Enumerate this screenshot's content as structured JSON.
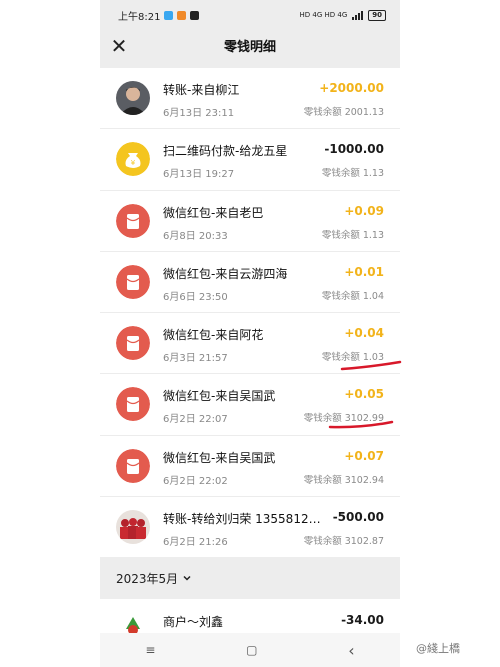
{
  "status": {
    "time": "上午8:21",
    "network": "HD 4G HD 4G",
    "battery": "90"
  },
  "header": {
    "title": "零钱明细",
    "close_icon": "close-icon"
  },
  "transactions": [
    {
      "title": "转账-来自柳江",
      "time": "6月13日 23:11",
      "amount": "+2000.00",
      "balance": "零钱余额 2001.13",
      "icon": "person-photo",
      "type": "pos"
    },
    {
      "title": "扫二维码付款-给龙五星",
      "time": "6月13日 19:27",
      "amount": "-1000.00",
      "balance": "零钱余额 1.13",
      "icon": "coin-bag-icon",
      "type": "neg"
    },
    {
      "title": "微信红包-来自老巴",
      "time": "6月8日 20:33",
      "amount": "+0.09",
      "balance": "零钱余额 1.13",
      "icon": "red-packet-icon",
      "type": "pos"
    },
    {
      "title": "微信红包-来自云游四海",
      "time": "6月6日 23:50",
      "amount": "+0.01",
      "balance": "零钱余额 1.04",
      "icon": "red-packet-icon",
      "type": "pos"
    },
    {
      "title": "微信红包-来自阿花",
      "time": "6月3日 21:57",
      "amount": "+0.04",
      "balance": "零钱余额 1.03",
      "icon": "red-packet-icon",
      "type": "pos"
    },
    {
      "title": "微信红包-来自吴国武",
      "time": "6月2日 22:07",
      "amount": "+0.05",
      "balance": "零钱余额 3102.99",
      "icon": "red-packet-icon",
      "type": "pos"
    },
    {
      "title": "微信红包-来自吴国武",
      "time": "6月2日 22:02",
      "amount": "+0.07",
      "balance": "零钱余额 3102.94",
      "icon": "red-packet-icon",
      "type": "pos"
    },
    {
      "title": "转账-转给刘归荣 1355812…",
      "time": "6月2日 21:26",
      "amount": "-500.00",
      "balance": "零钱余额 3102.87",
      "icon": "group-photo",
      "type": "neg"
    }
  ],
  "month_group": {
    "label": "2023年5月",
    "chevron": "chevron-down-icon"
  },
  "partial_row": {
    "title": "商户～刘鑫",
    "amount": "-34.00",
    "icon": "merchant-logo-icon"
  },
  "system_nav": {
    "menu": "≡",
    "home": "▢",
    "back": "‹"
  },
  "watermark": "@綫上橋",
  "colors": {
    "positive": "#f2b31a",
    "red_packet": "#e35b4e",
    "coin": "#f4c51f",
    "annotation": "#d8182a"
  }
}
